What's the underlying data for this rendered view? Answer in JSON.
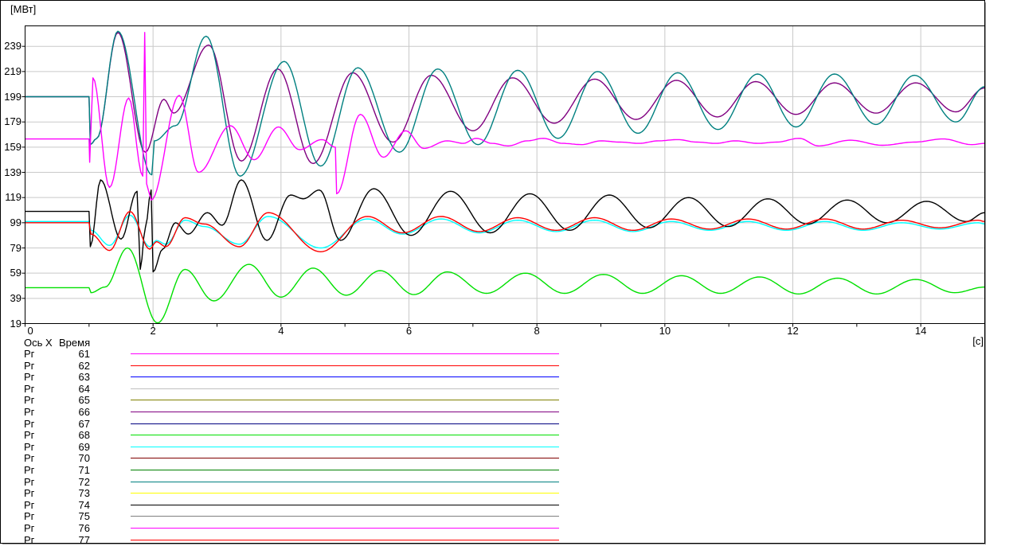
{
  "window": {
    "y_axis_unit": "[МВт]",
    "x_axis_unit": "[c]",
    "x_axis_name_label": "Ось X",
    "x_axis_name_value": "Время"
  },
  "colors": {
    "background": "#ffffff",
    "border": "#000000",
    "grid": "#c9c9c9",
    "text": "#000000"
  },
  "chart_data": {
    "type": "line",
    "title": "",
    "ylabel": "[МВт]",
    "xlabel": "Время [c]",
    "x_range": [
      0,
      15
    ],
    "y_ticks": [
      19,
      39,
      59,
      79,
      99,
      119,
      139,
      159,
      179,
      199,
      219,
      239
    ],
    "x_major_ticks": [
      0,
      2,
      4,
      6,
      8,
      10,
      12,
      14
    ],
    "x_minor_tick_step": 1,
    "grid": {
      "horizontal_step": 20,
      "vertical_step": 2,
      "color": "#c9c9c9"
    },
    "legend_position": "bottom-left",
    "legend": [
      {
        "label": "Рг",
        "value": "61",
        "color": "#ff00ff"
      },
      {
        "label": "Рг",
        "value": "62",
        "color": "#ff0000"
      },
      {
        "label": "Рг",
        "value": "63",
        "color": "#0000ff"
      },
      {
        "label": "Рг",
        "value": "64",
        "color": "#c0c0c0"
      },
      {
        "label": "Рг",
        "value": "65",
        "color": "#808000"
      },
      {
        "label": "Рг",
        "value": "66",
        "color": "#800080"
      },
      {
        "label": "Рг",
        "value": "67",
        "color": "#000080"
      },
      {
        "label": "Рг",
        "value": "68",
        "color": "#00e000"
      },
      {
        "label": "Рг",
        "value": "69",
        "color": "#00ffff"
      },
      {
        "label": "Рг",
        "value": "70",
        "color": "#800000"
      },
      {
        "label": "Рг",
        "value": "71",
        "color": "#008000"
      },
      {
        "label": "Рг",
        "value": "72",
        "color": "#008080"
      },
      {
        "label": "Рг",
        "value": "73",
        "color": "#ffff00"
      },
      {
        "label": "Рг",
        "value": "74",
        "color": "#000000"
      },
      {
        "label": "Рг",
        "value": "75",
        "color": "#808080"
      },
      {
        "label": "Рг",
        "value": "76",
        "color": "#ff00ff"
      },
      {
        "label": "Рг",
        "value": "77",
        "color": "#ff0000"
      }
    ],
    "series": [
      {
        "name": "Рг 66",
        "color": "#800080",
        "points": [
          [
            0,
            199
          ],
          [
            1,
            199
          ],
          [
            1.02,
            161
          ],
          [
            1.12,
            166
          ],
          [
            1.45,
            250
          ],
          [
            1.88,
            155
          ],
          [
            2.17,
            197
          ],
          [
            2.32,
            186
          ],
          [
            2.87,
            240
          ],
          [
            3.38,
            148
          ],
          [
            3.95,
            221
          ],
          [
            4.5,
            146
          ],
          [
            5.12,
            218
          ],
          [
            5.75,
            163
          ],
          [
            6.35,
            216
          ],
          [
            7.0,
            172
          ],
          [
            7.62,
            214
          ],
          [
            8.27,
            178
          ],
          [
            8.9,
            213
          ],
          [
            9.55,
            181
          ],
          [
            10.18,
            212
          ],
          [
            10.82,
            183
          ],
          [
            11.42,
            211
          ],
          [
            12.05,
            185
          ],
          [
            12.65,
            210
          ],
          [
            13.3,
            186
          ],
          [
            13.92,
            210
          ],
          [
            14.55,
            187
          ],
          [
            15,
            206
          ]
        ]
      },
      {
        "name": "Рг 68",
        "color": "#00e000",
        "points": [
          [
            0,
            47.5
          ],
          [
            1,
            47.5
          ],
          [
            1.03,
            43.5
          ],
          [
            1.25,
            48
          ],
          [
            1.6,
            79
          ],
          [
            2.07,
            19.5
          ],
          [
            2.5,
            62
          ],
          [
            2.95,
            37
          ],
          [
            3.5,
            66
          ],
          [
            4.0,
            40
          ],
          [
            4.5,
            63
          ],
          [
            5.02,
            41.5
          ],
          [
            5.55,
            61
          ],
          [
            6.08,
            42
          ],
          [
            6.6,
            60
          ],
          [
            7.21,
            43
          ],
          [
            7.82,
            59
          ],
          [
            8.43,
            43
          ],
          [
            9.04,
            58
          ],
          [
            9.65,
            43
          ],
          [
            10.26,
            57
          ],
          [
            10.87,
            43
          ],
          [
            11.48,
            56
          ],
          [
            12.09,
            42.5
          ],
          [
            12.7,
            55
          ],
          [
            13.31,
            42.5
          ],
          [
            13.92,
            54
          ],
          [
            14.53,
            43.5
          ],
          [
            15,
            48
          ]
        ]
      },
      {
        "name": "Рг 69",
        "color": "#00ffff",
        "points": [
          [
            0,
            100
          ],
          [
            1,
            100
          ],
          [
            1.03,
            93
          ],
          [
            1.32,
            81
          ],
          [
            1.64,
            105
          ],
          [
            1.95,
            80
          ],
          [
            2.05,
            85
          ],
          [
            2.2,
            82
          ],
          [
            2.5,
            101
          ],
          [
            2.8,
            96
          ],
          [
            3.35,
            82
          ],
          [
            3.8,
            104
          ],
          [
            4.62,
            79
          ],
          [
            5.35,
            102
          ],
          [
            5.9,
            90
          ],
          [
            6.5,
            102
          ],
          [
            7.1,
            91
          ],
          [
            7.7,
            101
          ],
          [
            8.3,
            92
          ],
          [
            8.9,
            101
          ],
          [
            9.5,
            92
          ],
          [
            10.1,
            100
          ],
          [
            10.7,
            93
          ],
          [
            11.3,
            100
          ],
          [
            11.9,
            93
          ],
          [
            12.5,
            100
          ],
          [
            13.1,
            93
          ],
          [
            13.7,
            99
          ],
          [
            14.3,
            94
          ],
          [
            14.9,
            99
          ],
          [
            15,
            98
          ]
        ]
      },
      {
        "name": "Рг 72",
        "color": "#008080",
        "points": [
          [
            0,
            199
          ],
          [
            1,
            199
          ],
          [
            1.02,
            161
          ],
          [
            1.12,
            166
          ],
          [
            1.45,
            251
          ],
          [
            1.98,
            137
          ],
          [
            2.02,
            164
          ],
          [
            2.35,
            176
          ],
          [
            2.83,
            247
          ],
          [
            3.36,
            136
          ],
          [
            4.05,
            227
          ],
          [
            4.62,
            144
          ],
          [
            5.2,
            222
          ],
          [
            5.85,
            155
          ],
          [
            6.45,
            221
          ],
          [
            7.08,
            161
          ],
          [
            7.7,
            220
          ],
          [
            8.33,
            166
          ],
          [
            8.95,
            219
          ],
          [
            9.58,
            170
          ],
          [
            10.2,
            218
          ],
          [
            10.83,
            173
          ],
          [
            11.45,
            217
          ],
          [
            12.05,
            175
          ],
          [
            12.65,
            217
          ],
          [
            13.3,
            177
          ],
          [
            13.9,
            216
          ],
          [
            14.55,
            179
          ],
          [
            15,
            207
          ]
        ]
      },
      {
        "name": "Рг 74",
        "color": "#000000",
        "points": [
          [
            0,
            108
          ],
          [
            1,
            108
          ],
          [
            1.02,
            80
          ],
          [
            1.18,
            133
          ],
          [
            1.5,
            86
          ],
          [
            1.75,
            124
          ],
          [
            1.8,
            62
          ],
          [
            1.88,
            95
          ],
          [
            1.97,
            125
          ],
          [
            2.0,
            60
          ],
          [
            2.15,
            78
          ],
          [
            2.35,
            99
          ],
          [
            2.55,
            90
          ],
          [
            2.85,
            107
          ],
          [
            3.08,
            97
          ],
          [
            3.38,
            133
          ],
          [
            3.78,
            85
          ],
          [
            4.15,
            121
          ],
          [
            4.35,
            118
          ],
          [
            4.6,
            125
          ],
          [
            4.93,
            85
          ],
          [
            5.45,
            126
          ],
          [
            6.03,
            89
          ],
          [
            6.65,
            124
          ],
          [
            7.27,
            91
          ],
          [
            7.89,
            122
          ],
          [
            8.51,
            93
          ],
          [
            9.13,
            121
          ],
          [
            9.75,
            95
          ],
          [
            10.37,
            119
          ],
          [
            10.99,
            96
          ],
          [
            11.61,
            118
          ],
          [
            12.23,
            98
          ],
          [
            12.85,
            117
          ],
          [
            13.47,
            99
          ],
          [
            14.09,
            116
          ],
          [
            14.71,
            100
          ],
          [
            15,
            107
          ]
        ]
      },
      {
        "name": "Рг 76",
        "color": "#ff00ff",
        "points": [
          [
            0,
            165.5
          ],
          [
            1,
            165.5
          ],
          [
            1.01,
            147
          ],
          [
            1.06,
            214
          ],
          [
            1.32,
            127
          ],
          [
            1.62,
            198
          ],
          [
            1.84,
            136
          ],
          [
            1.87,
            250
          ],
          [
            1.9,
            130
          ],
          [
            1.97,
            117
          ],
          [
            2.41,
            200
          ],
          [
            2.71,
            139
          ],
          [
            3.21,
            176
          ],
          [
            3.58,
            149
          ],
          [
            3.96,
            175
          ],
          [
            4.29,
            157
          ],
          [
            4.64,
            165
          ],
          [
            4.85,
            159
          ],
          [
            4.87,
            122
          ],
          [
            5.24,
            185
          ],
          [
            5.6,
            151
          ],
          [
            5.95,
            172
          ],
          [
            6.23,
            158
          ],
          [
            6.6,
            164
          ],
          [
            6.85,
            162
          ],
          [
            7.05,
            166
          ],
          [
            7.3,
            162
          ],
          [
            7.55,
            160
          ],
          [
            7.85,
            164
          ],
          [
            8.1,
            166
          ],
          [
            8.4,
            162
          ],
          [
            8.7,
            161
          ],
          [
            9.0,
            164
          ],
          [
            9.3,
            163
          ],
          [
            9.6,
            162
          ],
          [
            9.9,
            164
          ],
          [
            10.2,
            165
          ],
          [
            10.5,
            163
          ],
          [
            10.8,
            162
          ],
          [
            11.1,
            164
          ],
          [
            11.45,
            162
          ],
          [
            11.75,
            163
          ],
          [
            12.1,
            166
          ],
          [
            12.4,
            160
          ],
          [
            12.9,
            164.5
          ],
          [
            13.4,
            160.5
          ],
          [
            13.9,
            163
          ],
          [
            14.35,
            165.5
          ],
          [
            14.8,
            161
          ],
          [
            15,
            162
          ]
        ]
      },
      {
        "name": "Рг 77",
        "color": "#ff0000",
        "points": [
          [
            0,
            99
          ],
          [
            1,
            99
          ],
          [
            1.03,
            90
          ],
          [
            1.32,
            77
          ],
          [
            1.64,
            108
          ],
          [
            1.95,
            78
          ],
          [
            2.05,
            84
          ],
          [
            2.2,
            80
          ],
          [
            2.5,
            103
          ],
          [
            2.8,
            98
          ],
          [
            3.35,
            80
          ],
          [
            3.8,
            107
          ],
          [
            4.62,
            76
          ],
          [
            5.35,
            104
          ],
          [
            5.9,
            91
          ],
          [
            6.5,
            104
          ],
          [
            7.1,
            92
          ],
          [
            7.7,
            103
          ],
          [
            8.3,
            93
          ],
          [
            8.9,
            103
          ],
          [
            9.5,
            93
          ],
          [
            10.1,
            102
          ],
          [
            10.7,
            94
          ],
          [
            11.3,
            102
          ],
          [
            11.9,
            94
          ],
          [
            12.5,
            102
          ],
          [
            13.1,
            94
          ],
          [
            13.7,
            101
          ],
          [
            14.3,
            95
          ],
          [
            14.9,
            101
          ],
          [
            15,
            100
          ]
        ]
      }
    ]
  }
}
